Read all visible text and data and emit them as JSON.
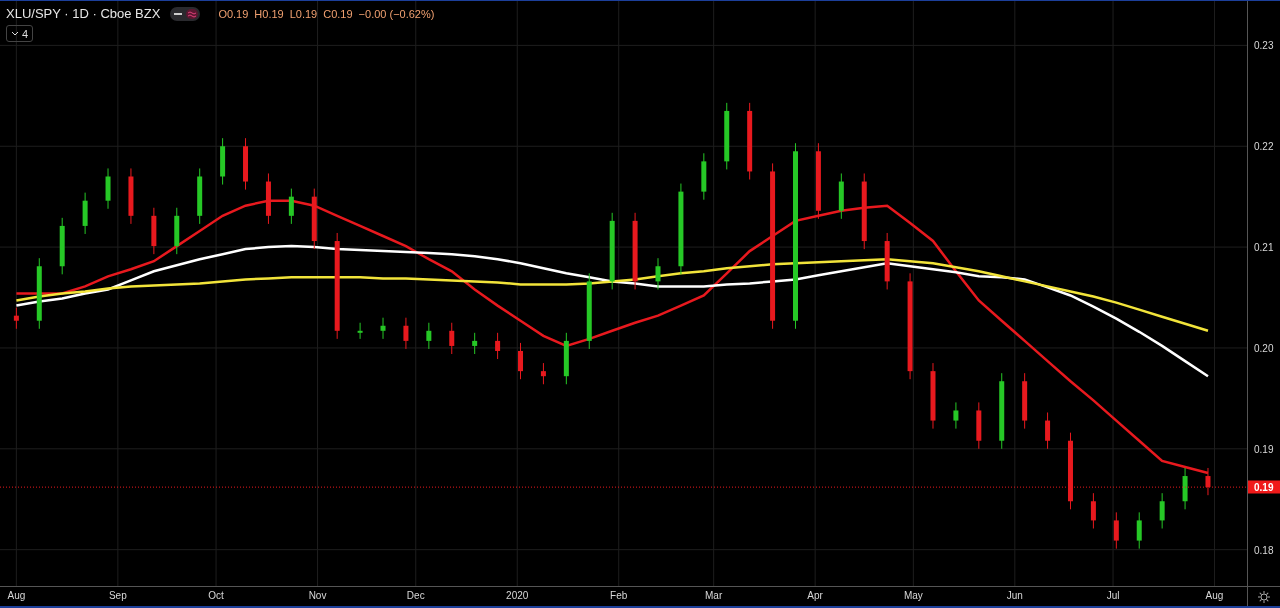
{
  "legend": {
    "symbol": "XLU/SPY · 1D · Cboe BZX",
    "ohlc": [
      "O0.19",
      "H0.19",
      "L0.19",
      "C0.19"
    ],
    "change": "−0.00 (−0.62%)",
    "collapse_count": "4"
  },
  "chart": {
    "chart_data": {
      "type": "candlestick",
      "xlim": [
        "2019-07-27",
        "2020-08-21"
      ],
      "ylim": [
        0.1761,
        0.2344
      ],
      "grid": true,
      "x": [
        "2019-08-01",
        "2019-08-08",
        "2019-08-15",
        "2019-08-22",
        "2019-08-29",
        "2019-09-05",
        "2019-09-12",
        "2019-09-19",
        "2019-09-26",
        "2019-10-03",
        "2019-10-10",
        "2019-10-17",
        "2019-10-24",
        "2019-10-31",
        "2019-11-07",
        "2019-11-14",
        "2019-11-21",
        "2019-11-28",
        "2019-12-05",
        "2019-12-12",
        "2019-12-19",
        "2019-12-26",
        "2020-01-02",
        "2020-01-09",
        "2020-01-16",
        "2020-01-23",
        "2020-01-30",
        "2020-02-06",
        "2020-02-13",
        "2020-02-20",
        "2020-02-27",
        "2020-03-05",
        "2020-03-12",
        "2020-03-19",
        "2020-03-26",
        "2020-04-02",
        "2020-04-09",
        "2020-04-16",
        "2020-04-23",
        "2020-04-30",
        "2020-05-07",
        "2020-05-14",
        "2020-05-21",
        "2020-05-28",
        "2020-06-04",
        "2020-06-11",
        "2020-06-18",
        "2020-06-25",
        "2020-07-02",
        "2020-07-09",
        "2020-07-16",
        "2020-07-23",
        "2020-07-30"
      ],
      "ohlc": [
        [
          0.2032,
          0.204,
          0.2019,
          0.2027
        ],
        [
          0.2027,
          0.2089,
          0.2019,
          0.2081
        ],
        [
          0.2081,
          0.2129,
          0.2073,
          0.2121
        ],
        [
          0.2121,
          0.2154,
          0.2113,
          0.2146
        ],
        [
          0.2146,
          0.2178,
          0.2138,
          0.217
        ],
        [
          0.217,
          0.2178,
          0.2123,
          0.2131
        ],
        [
          0.2131,
          0.2139,
          0.2093,
          0.2101
        ],
        [
          0.2101,
          0.2139,
          0.2093,
          0.2131
        ],
        [
          0.2131,
          0.2178,
          0.2123,
          0.217
        ],
        [
          0.217,
          0.2208,
          0.2162,
          0.22
        ],
        [
          0.22,
          0.2208,
          0.2157,
          0.2165
        ],
        [
          0.2165,
          0.2173,
          0.2123,
          0.2131
        ],
        [
          0.2131,
          0.2158,
          0.2123,
          0.215
        ],
        [
          0.215,
          0.2158,
          0.2098,
          0.2106
        ],
        [
          0.2106,
          0.2114,
          0.2009,
          0.2017
        ],
        [
          0.2017,
          0.2025,
          0.2009,
          0.2017
        ],
        [
          0.2017,
          0.203,
          0.2009,
          0.2022
        ],
        [
          0.2022,
          0.203,
          0.1999,
          0.2007
        ],
        [
          0.2007,
          0.2025,
          0.1999,
          0.2017
        ],
        [
          0.2017,
          0.2025,
          0.1994,
          0.2002
        ],
        [
          0.2002,
          0.2015,
          0.1994,
          0.2007
        ],
        [
          0.2007,
          0.2015,
          0.1989,
          0.1997
        ],
        [
          0.1997,
          0.2005,
          0.1969,
          0.1977
        ],
        [
          0.1977,
          0.1985,
          0.1964,
          0.1972
        ],
        [
          0.1972,
          0.2015,
          0.1964,
          0.2007
        ],
        [
          0.2007,
          0.2074,
          0.1999,
          0.2066
        ],
        [
          0.2066,
          0.2134,
          0.2058,
          0.2126
        ],
        [
          0.2126,
          0.2134,
          0.2058,
          0.2066
        ],
        [
          0.2066,
          0.2089,
          0.2058,
          0.2081
        ],
        [
          0.2081,
          0.2163,
          0.2073,
          0.2155
        ],
        [
          0.2155,
          0.2193,
          0.2147,
          0.2185
        ],
        [
          0.2185,
          0.2243,
          0.2177,
          0.2235
        ],
        [
          0.2235,
          0.2243,
          0.2167,
          0.2175
        ],
        [
          0.2175,
          0.2183,
          0.2019,
          0.2027
        ],
        [
          0.2027,
          0.2203,
          0.2019,
          0.2195
        ],
        [
          0.2195,
          0.2203,
          0.2128,
          0.2136
        ],
        [
          0.2136,
          0.2173,
          0.2128,
          0.2165
        ],
        [
          0.2165,
          0.2173,
          0.2098,
          0.2106
        ],
        [
          0.2106,
          0.2114,
          0.2058,
          0.2066
        ],
        [
          0.2066,
          0.2074,
          0.1969,
          0.1977
        ],
        [
          0.1977,
          0.1985,
          0.192,
          0.1928
        ],
        [
          0.1928,
          0.1946,
          0.192,
          0.1938
        ],
        [
          0.1938,
          0.1946,
          0.19,
          0.1908
        ],
        [
          0.1908,
          0.1975,
          0.19,
          0.1967
        ],
        [
          0.1967,
          0.1975,
          0.192,
          0.1928
        ],
        [
          0.1928,
          0.1936,
          0.19,
          0.1908
        ],
        [
          0.1908,
          0.1916,
          0.184,
          0.1848
        ],
        [
          0.1848,
          0.1856,
          0.1821,
          0.1829
        ],
        [
          0.1829,
          0.1837,
          0.1801,
          0.1809
        ],
        [
          0.1809,
          0.1837,
          0.1801,
          0.1829
        ],
        [
          0.1829,
          0.1856,
          0.1821,
          0.1848
        ],
        [
          0.1848,
          0.1881,
          0.184,
          0.1873
        ],
        [
          0.1873,
          0.1881,
          0.1854,
          0.1862
        ]
      ],
      "series": [
        {
          "type": "line",
          "color": "#e8191e",
          "values": [
            0.2054,
            0.2054,
            0.2054,
            0.2061,
            0.2071,
            0.2078,
            0.2086,
            0.2101,
            0.2116,
            0.2131,
            0.2141,
            0.2146,
            0.2146,
            0.2141,
            0.2131,
            0.2121,
            0.2111,
            0.2101,
            0.2088,
            0.2076,
            0.2058,
            0.2042,
            0.2027,
            0.2012,
            0.2002,
            0.2009,
            0.2017,
            0.2025,
            0.2032,
            0.2042,
            0.2052,
            0.2074,
            0.2096,
            0.2111,
            0.2126,
            0.2131,
            0.2136,
            0.2139,
            0.2141,
            0.2124,
            0.2106,
            0.2076,
            0.2047,
            0.2027,
            0.2007,
            0.1987,
            0.1967,
            0.1948,
            0.1928,
            0.1908,
            0.1888,
            0.1882,
            0.1876
          ]
        },
        {
          "type": "line",
          "color": "#ffffff",
          "values": [
            0.2042,
            0.2046,
            0.2049,
            0.2054,
            0.2058,
            0.2067,
            0.2076,
            0.2082,
            0.2088,
            0.2093,
            0.2098,
            0.21,
            0.2101,
            0.21,
            0.2098,
            0.2097,
            0.2096,
            0.2095,
            0.2094,
            0.2093,
            0.2091,
            0.2088,
            0.2084,
            0.2079,
            0.2074,
            0.207,
            0.2066,
            0.2064,
            0.2061,
            0.2061,
            0.2061,
            0.2063,
            0.2064,
            0.2066,
            0.2068,
            0.2072,
            0.2076,
            0.208,
            0.2084,
            0.2081,
            0.2078,
            0.2075,
            0.2071,
            0.207,
            0.2068,
            0.206,
            0.2052,
            0.2041,
            0.2029,
            0.2016,
            0.2002,
            0.1987,
            0.1972
          ]
        },
        {
          "type": "line",
          "color": "#f2e43a",
          "values": [
            0.2047,
            0.2051,
            0.2054,
            0.2056,
            0.2059,
            0.2061,
            0.2062,
            0.2063,
            0.2064,
            0.2066,
            0.2068,
            0.2069,
            0.207,
            0.207,
            0.207,
            0.207,
            0.2069,
            0.2069,
            0.2068,
            0.2067,
            0.2066,
            0.2065,
            0.2063,
            0.2063,
            0.2063,
            0.2064,
            0.2066,
            0.2068,
            0.2071,
            0.2074,
            0.2076,
            0.2079,
            0.2081,
            0.2083,
            0.2084,
            0.2085,
            0.2086,
            0.2087,
            0.2088,
            0.2086,
            0.2084,
            0.208,
            0.2076,
            0.2071,
            0.2066,
            0.2061,
            0.2056,
            0.2051,
            0.2045,
            0.2038,
            0.2031,
            0.2024,
            0.2017
          ]
        }
      ],
      "ref_lines": [
        {
          "axis": "y",
          "value": 0.1862,
          "color": "#e8191e"
        }
      ],
      "xticks": [
        {
          "value": "2019-08-01",
          "label": "Aug"
        },
        {
          "value": "2019-09-01",
          "label": "Sep"
        },
        {
          "value": "2019-10-01",
          "label": "Oct"
        },
        {
          "value": "2019-11-01",
          "label": "Nov"
        },
        {
          "value": "2019-12-01",
          "label": "Dec"
        },
        {
          "value": "2020-01-01",
          "label": "2020"
        },
        {
          "value": "2020-02-01",
          "label": "Feb"
        },
        {
          "value": "2020-03-01",
          "label": "Mar"
        },
        {
          "value": "2020-04-01",
          "label": "Apr"
        },
        {
          "value": "2020-05-01",
          "label": "May"
        },
        {
          "value": "2020-06-01",
          "label": "Jun"
        },
        {
          "value": "2020-07-01",
          "label": "Jul"
        },
        {
          "value": "2020-08-01",
          "label": "Aug"
        }
      ],
      "yticks": [
        {
          "value": 0.23,
          "label": "0.23"
        },
        {
          "value": 0.22,
          "label": "0.22"
        },
        {
          "value": 0.21,
          "label": "0.21"
        },
        {
          "value": 0.2,
          "label": "0.20"
        },
        {
          "value": 0.19,
          "label": "0.19"
        },
        {
          "value": 0.18,
          "label": "0.18"
        }
      ]
    },
    "last_price_label": "0.19"
  }
}
